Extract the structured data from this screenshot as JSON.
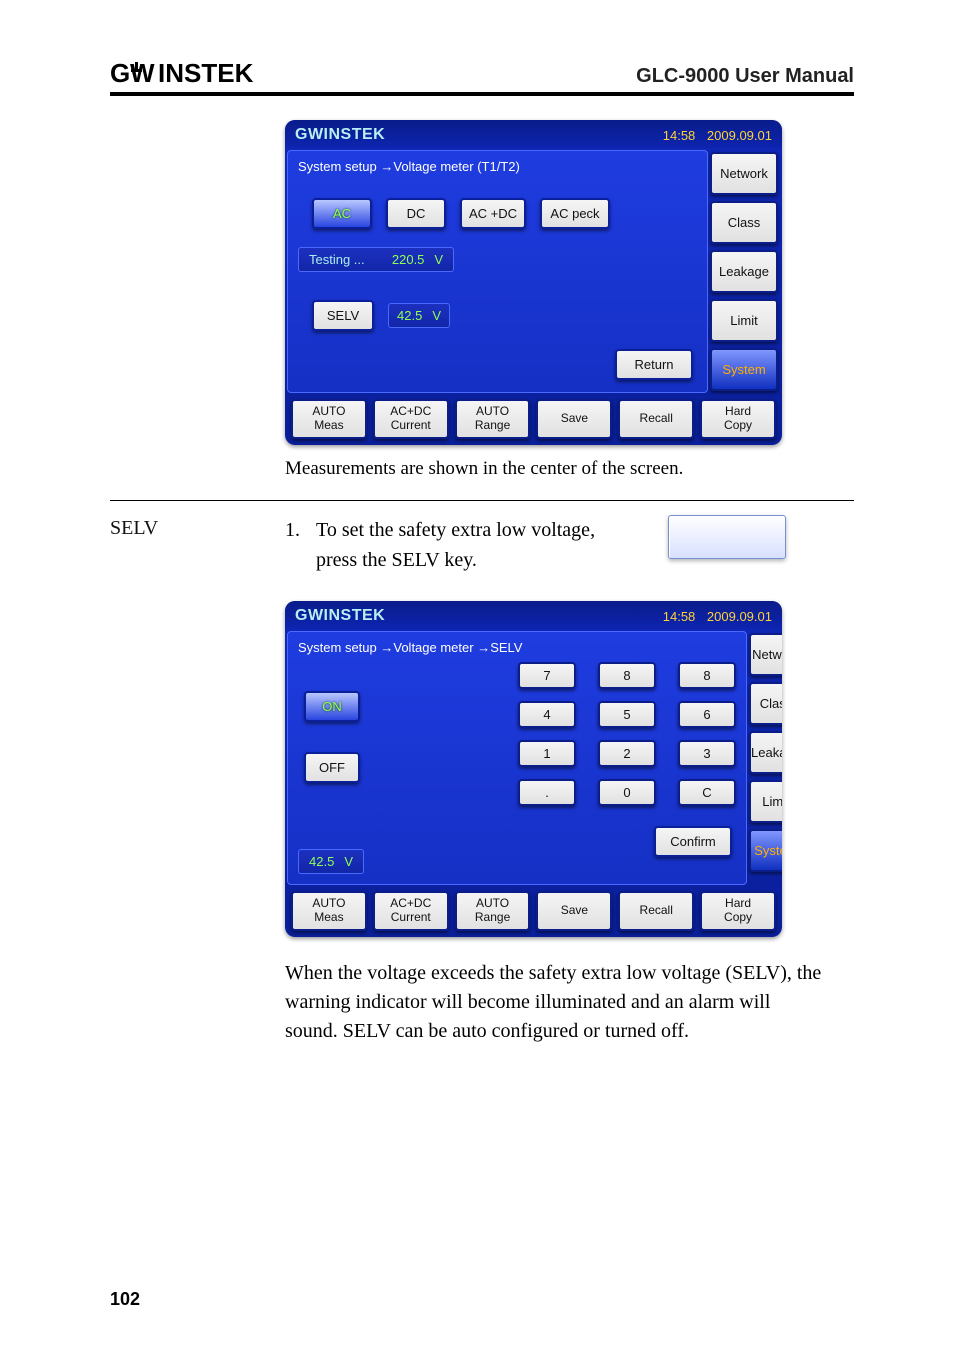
{
  "header": {
    "brand_svg_label": "GWINSTEK",
    "manual_title": "GLC-9000 User Manual"
  },
  "caption1": "Measurements are shown in the center of the screen.",
  "section": {
    "label": "SELV",
    "step_num": "1.",
    "step_text": "To set the safety extra low voltage, press the SELV key."
  },
  "para": "When the voltage exceeds the safety extra low voltage (SELV), the warning indicator will become illuminated and an alarm will sound. SELV can be auto configured or turned off.",
  "page_num": "102",
  "screen1": {
    "logo": "GWINSTEK",
    "time": "14:58",
    "date": "2009.09.01",
    "breadcrumb": "System setup →Voltage meter (T1/T2)",
    "row1": {
      "b1": "AC",
      "b2": "DC",
      "b3": "AC +DC",
      "b4": "AC peck"
    },
    "testing_label": "Testing ...",
    "testing_value": "220.5",
    "testing_unit": "V",
    "selv_label": "SELV",
    "selv_value": "42.5",
    "selv_unit": "V",
    "return_label": "Return",
    "side": {
      "s1": "Network",
      "s2": "Class",
      "s3": "Leakage",
      "s4": "Limit",
      "s5": "System"
    },
    "bottom": {
      "b1a": "AUTO",
      "b1b": "Meas",
      "b2a": "AC+DC",
      "b2b": "Current",
      "b3a": "AUTO",
      "b3b": "Range",
      "b4": "Save",
      "b5": "Recall",
      "b6a": "Hard",
      "b6b": "Copy"
    }
  },
  "screen2": {
    "logo": "GWINSTEK",
    "time": "14:58",
    "date": "2009.09.01",
    "breadcrumb": "System setup →Voltage meter →SELV",
    "on_label": "ON",
    "off_label": "OFF",
    "value": "42.5",
    "unit": "V",
    "confirm_label": "Confirm",
    "keys": {
      "k7": "7",
      "k8": "8",
      "k9": "8",
      "k4": "4",
      "k5": "5",
      "k6": "6",
      "k1": "1",
      "k2": "2",
      "k3": "3",
      "kd": ".",
      "k0": "0",
      "kc": "C"
    },
    "side": {
      "s1": "Network",
      "s2": "Class",
      "s3": "Leakage",
      "s4": "Limit",
      "s5": "System"
    },
    "bottom": {
      "b1a": "AUTO",
      "b1b": "Meas",
      "b2a": "AC+DC",
      "b2b": "Current",
      "b3a": "AUTO",
      "b3b": "Range",
      "b4": "Save",
      "b5": "Recall",
      "b6a": "Hard",
      "b6b": "Copy"
    }
  }
}
